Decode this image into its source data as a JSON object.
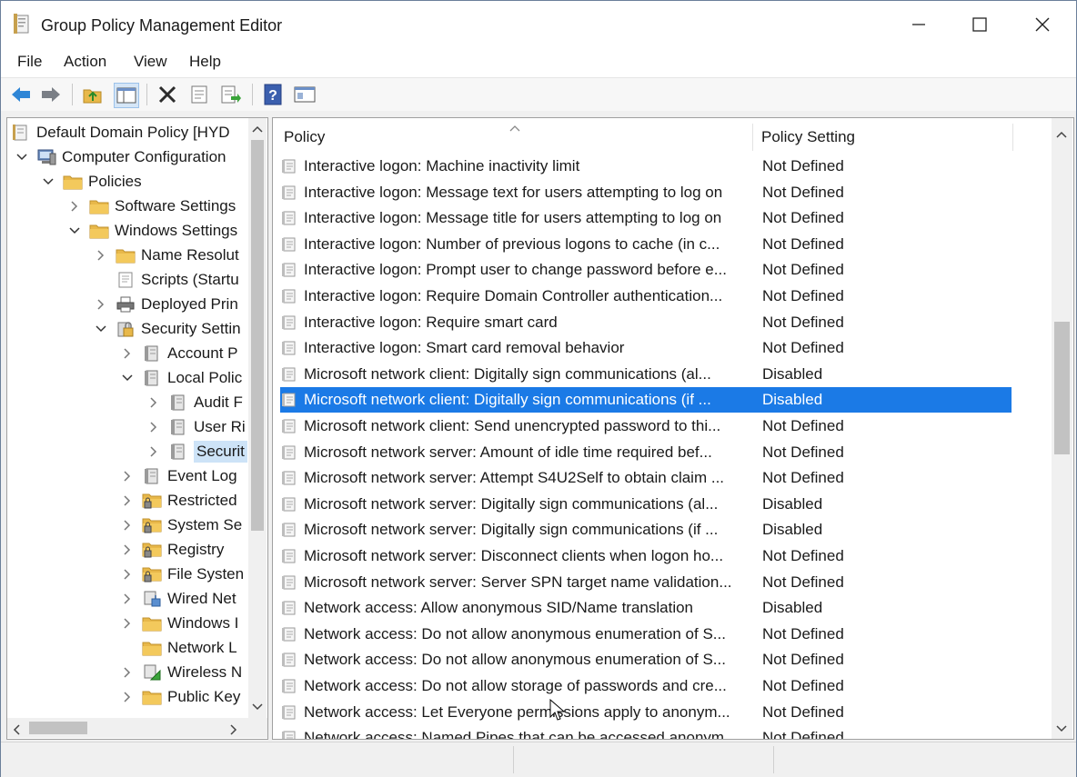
{
  "window": {
    "title": "Group Policy Management Editor"
  },
  "menu": [
    "File",
    "Action",
    "View",
    "Help"
  ],
  "toolbar": [
    "back-icon",
    "forward-icon",
    "up-folder-icon",
    "show-hide-tree-icon",
    "delete-icon",
    "properties-icon",
    "export-list-icon",
    "help-icon",
    "console-view-icon"
  ],
  "tree": {
    "nodes": [
      {
        "label": "Default Domain Policy [HYD",
        "depth": 0,
        "expander": "none",
        "icon": "policy-doc-icon"
      },
      {
        "label": "Computer Configuration",
        "depth": 1,
        "expander": "open",
        "icon": "computer-icon"
      },
      {
        "label": "Policies",
        "depth": 2,
        "expander": "open",
        "icon": "folder-icon"
      },
      {
        "label": "Software Settings",
        "depth": 3,
        "expander": "closed",
        "icon": "folder-icon"
      },
      {
        "label": "Windows Settings",
        "depth": 3,
        "expander": "open",
        "icon": "folder-icon"
      },
      {
        "label": "Name Resolut",
        "depth": 4,
        "expander": "closed",
        "icon": "folder-icon"
      },
      {
        "label": "Scripts (Startu",
        "depth": 4,
        "expander": "none",
        "icon": "script-icon"
      },
      {
        "label": "Deployed Prin",
        "depth": 4,
        "expander": "closed",
        "icon": "printer-icon"
      },
      {
        "label": "Security Settin",
        "depth": 4,
        "expander": "open",
        "icon": "security-icon"
      },
      {
        "label": "Account P",
        "depth": 5,
        "expander": "closed",
        "icon": "policy-book-icon"
      },
      {
        "label": "Local Polic",
        "depth": 5,
        "expander": "open",
        "icon": "policy-book-icon"
      },
      {
        "label": "Audit F",
        "depth": 6,
        "expander": "closed",
        "icon": "policy-book-icon"
      },
      {
        "label": "User Ri",
        "depth": 6,
        "expander": "closed",
        "icon": "policy-book-icon"
      },
      {
        "label": "Securit",
        "depth": 6,
        "expander": "closed",
        "icon": "policy-book-icon",
        "selected": true
      },
      {
        "label": "Event Log",
        "depth": 5,
        "expander": "closed",
        "icon": "policy-book-icon"
      },
      {
        "label": "Restricted",
        "depth": 5,
        "expander": "closed",
        "icon": "locked-folder-icon"
      },
      {
        "label": "System Se",
        "depth": 5,
        "expander": "closed",
        "icon": "locked-folder-icon"
      },
      {
        "label": "Registry",
        "depth": 5,
        "expander": "closed",
        "icon": "locked-folder-icon"
      },
      {
        "label": "File Systen",
        "depth": 5,
        "expander": "closed",
        "icon": "locked-folder-icon"
      },
      {
        "label": "Wired Net",
        "depth": 5,
        "expander": "closed",
        "icon": "wired-network-icon"
      },
      {
        "label": "Windows I",
        "depth": 5,
        "expander": "closed",
        "icon": "folder-icon"
      },
      {
        "label": "Network L",
        "depth": 5,
        "expander": "none",
        "icon": "folder-icon"
      },
      {
        "label": "Wireless N",
        "depth": 5,
        "expander": "closed",
        "icon": "wireless-network-icon"
      },
      {
        "label": "Public Key",
        "depth": 5,
        "expander": "closed",
        "icon": "folder-icon"
      }
    ]
  },
  "list": {
    "columns": {
      "policy": "Policy",
      "setting": "Policy Setting"
    },
    "rows": [
      {
        "policy": "Interactive logon: Machine inactivity limit",
        "setting": "Not Defined"
      },
      {
        "policy": "Interactive logon: Message text for users attempting to log on",
        "setting": "Not Defined"
      },
      {
        "policy": "Interactive logon: Message title for users attempting to log on",
        "setting": "Not Defined"
      },
      {
        "policy": "Interactive logon: Number of previous logons to cache (in c...",
        "setting": "Not Defined"
      },
      {
        "policy": "Interactive logon: Prompt user to change password before e...",
        "setting": "Not Defined"
      },
      {
        "policy": "Interactive logon: Require Domain Controller authentication...",
        "setting": "Not Defined"
      },
      {
        "policy": "Interactive logon: Require smart card",
        "setting": "Not Defined"
      },
      {
        "policy": "Interactive logon: Smart card removal behavior",
        "setting": "Not Defined"
      },
      {
        "policy": "Microsoft network client: Digitally sign communications (al...",
        "setting": "Disabled"
      },
      {
        "policy": "Microsoft network client: Digitally sign communications (if ...",
        "setting": "Disabled",
        "selected": true
      },
      {
        "policy": "Microsoft network client: Send unencrypted password to thi...",
        "setting": "Not Defined"
      },
      {
        "policy": "Microsoft network server: Amount of idle time required bef...",
        "setting": "Not Defined"
      },
      {
        "policy": "Microsoft network server: Attempt S4U2Self to obtain claim ...",
        "setting": "Not Defined"
      },
      {
        "policy": "Microsoft network server: Digitally sign communications (al...",
        "setting": "Disabled"
      },
      {
        "policy": "Microsoft network server: Digitally sign communications (if ...",
        "setting": "Disabled"
      },
      {
        "policy": "Microsoft network server: Disconnect clients when logon ho...",
        "setting": "Not Defined"
      },
      {
        "policy": "Microsoft network server: Server SPN target name validation...",
        "setting": "Not Defined"
      },
      {
        "policy": "Network access: Allow anonymous SID/Name translation",
        "setting": "Disabled"
      },
      {
        "policy": "Network access: Do not allow anonymous enumeration of S...",
        "setting": "Not Defined"
      },
      {
        "policy": "Network access: Do not allow anonymous enumeration of S...",
        "setting": "Not Defined"
      },
      {
        "policy": "Network access: Do not allow storage of passwords and cre...",
        "setting": "Not Defined"
      },
      {
        "policy": "Network access: Let Everyone permissions apply to anonym...",
        "setting": "Not Defined"
      },
      {
        "policy": "Network access: Named Pipes that can be accessed anonym...",
        "setting": "Not Defined"
      }
    ]
  },
  "colors": {
    "selection": "#1b7ae6",
    "folder": "#e8b84a"
  }
}
